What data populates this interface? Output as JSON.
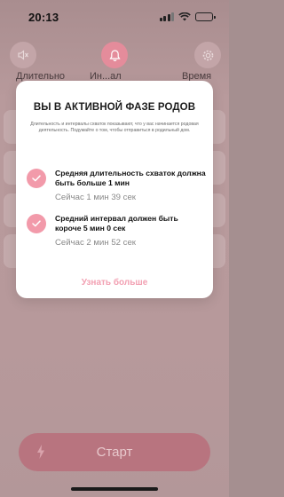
{
  "status_bar": {
    "time": "20:13"
  },
  "top_bar": {
    "left_label": "Длительно",
    "middle_label": "Ин...ал",
    "right_label": "Время"
  },
  "modal": {
    "title": "ВЫ В АКТИВНОЙ ФАЗЕ РОДОВ",
    "description": "Длительность и интервалы схваток показывают, что у вас начинается родовая деятельность. Подумайте о том, чтобы отправиться в родильный дом.",
    "items": [
      {
        "title": "Средняя длительность схваток должна быть больше 1 мин",
        "current": "Сейчас 1 мин 39 сек"
      },
      {
        "title": "Средний интервал должен быть короче 5 мин 0 сек",
        "current": "Сейчас 2 мин 52 сек"
      }
    ],
    "learn_more": "Узнать больше"
  },
  "start_button": {
    "label": "Старт"
  },
  "colors": {
    "accent": "#f29aaa",
    "link": "#f2a0b2",
    "start_button": "#b8747f"
  },
  "icons": {
    "sound": "speaker-muted-icon",
    "bell": "bell-icon",
    "settings": "gear-icon",
    "check": "check-icon",
    "start": "lightning-bolt-icon"
  }
}
